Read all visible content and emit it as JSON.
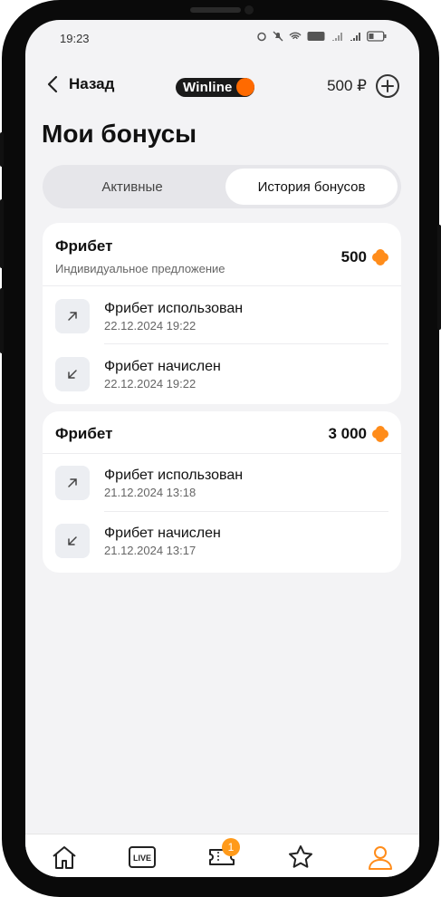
{
  "status_bar": {
    "time": "19:23",
    "icons": [
      "alarm-icon",
      "mute-icon",
      "wifi-icon",
      "volte-icon",
      "signal-icon",
      "signal-icon",
      "battery-icon"
    ]
  },
  "header": {
    "back_label": "Назад",
    "logo_text": "Winline",
    "balance": "500 ₽"
  },
  "page": {
    "title": "Мои бонусы"
  },
  "tabs": [
    {
      "label": "Активные",
      "selected": false
    },
    {
      "label": "История бонусов",
      "selected": true
    }
  ],
  "cards": [
    {
      "title": "Фрибет",
      "subtitle": "Индивидуальное предложение",
      "amount": "500",
      "rows": [
        {
          "title": "Фрибет использован",
          "date": "22.12.2024 19:22",
          "icon": "arrow-up-right-icon"
        },
        {
          "title": "Фрибет начислен",
          "date": "22.12.2024 19:22",
          "icon": "arrow-down-left-icon"
        }
      ]
    },
    {
      "title": "Фрибет",
      "amount": "3 000",
      "rows": [
        {
          "title": "Фрибет использован",
          "date": "21.12.2024 13:18",
          "icon": "arrow-up-right-icon"
        },
        {
          "title": "Фрибет начислен",
          "date": "21.12.2024 13:17",
          "icon": "arrow-down-left-icon"
        }
      ]
    }
  ],
  "bottom_nav": {
    "items": [
      {
        "name": "home",
        "icon": "home-icon"
      },
      {
        "name": "live",
        "icon": "live-icon",
        "label": "LIVE"
      },
      {
        "name": "coupon",
        "icon": "ticket-icon",
        "badge": "1"
      },
      {
        "name": "favorites",
        "icon": "star-icon"
      },
      {
        "name": "profile",
        "icon": "profile-icon",
        "active": true
      }
    ]
  },
  "colors": {
    "accent": "#ff8c1a",
    "logo_dot": "#ff6a00",
    "background": "#f3f3f5"
  }
}
